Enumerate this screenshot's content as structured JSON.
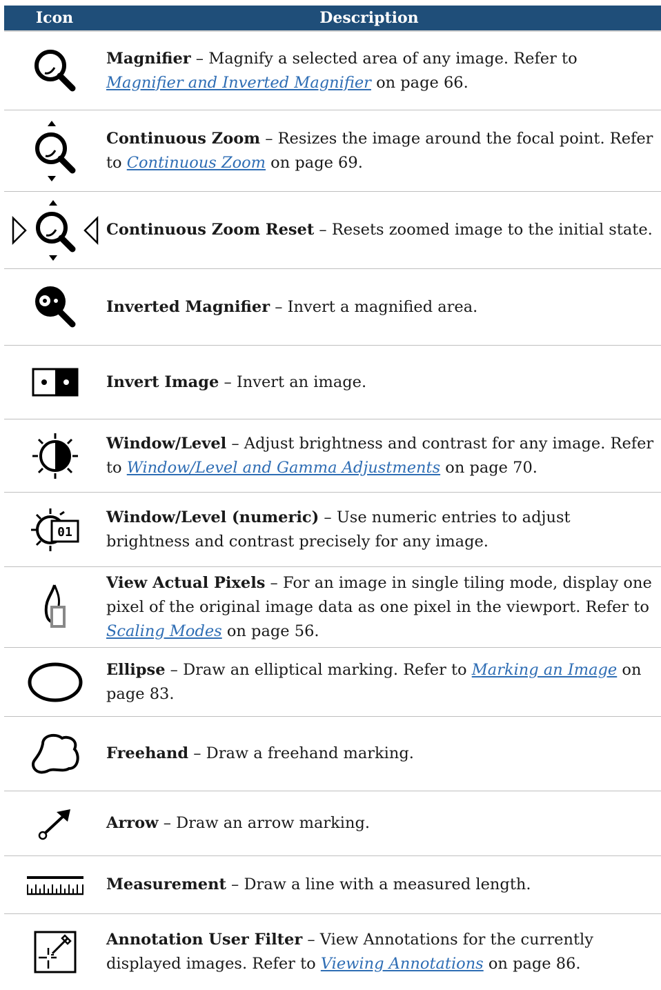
{
  "header": {
    "icon_col": "Icon",
    "desc_col": "Description"
  },
  "rows": [
    {
      "title": "Magnifier",
      "sep": " – ",
      "text": "Magnify a selected area of any image. Refer to ",
      "link": "Magnifier and Inverted Magnifier",
      "tail": " on page 66.",
      "icon": "magnifier-icon"
    },
    {
      "title": "Continuous Zoom",
      "sep": " – ",
      "text": "Resizes the image around the focal point. Refer to ",
      "link": "Continuous Zoom",
      "tail": " on page 69.",
      "icon": "continuous-zoom-icon"
    },
    {
      "title": "Continuous Zoom Reset",
      "sep": " – ",
      "text": "Resets zoomed image to the initial state.",
      "icon": "continuous-zoom-reset-icon"
    },
    {
      "title": "Inverted Magnifier",
      "sep": " – ",
      "text": "Invert a magnified area.",
      "icon": "inverted-magnifier-icon"
    },
    {
      "title": "Invert Image",
      "sep": " – ",
      "text": "Invert an image.",
      "icon": "invert-image-icon"
    },
    {
      "title": "Window/Level",
      "sep": " – ",
      "text": "Adjust brightness and contrast for any image. Refer to ",
      "link": "Window/Level and Gamma Adjustments",
      "tail": " on page 70.",
      "icon": "window-level-icon"
    },
    {
      "title": "Window/Level (numeric)",
      "sep": " – ",
      "text": "Use numeric entries to adjust brightness and contrast precisely for any image.",
      "icon": "window-level-numeric-icon",
      "icon_label": "01"
    },
    {
      "title": "View Actual Pixels",
      "sep": " – ",
      "text": "For an image in single tiling mode, display one pixel of the original image data as one pixel in the viewport. Refer to ",
      "link": "Scaling Modes",
      "tail": " on page 56.",
      "icon": "view-actual-pixels-icon"
    },
    {
      "title": "Ellipse",
      "sep": " – ",
      "text": "Draw an elliptical marking. Refer to ",
      "link": "Marking an Image",
      "tail": " on page 83.",
      "icon": "ellipse-icon"
    },
    {
      "title": "Freehand",
      "sep": " – ",
      "text": "Draw a freehand marking.",
      "icon": "freehand-icon"
    },
    {
      "title": "Arrow",
      "sep": " – ",
      "text": "Draw an arrow marking.",
      "icon": "arrow-icon"
    },
    {
      "title": "Measurement",
      "sep": " – ",
      "text": "Draw a line with a measured length.",
      "icon": "measurement-icon"
    },
    {
      "title": "Annotation User Filter",
      "sep": " – ",
      "text": "View Annotations for the currently displayed images. Refer to ",
      "link": "Viewing Annotations",
      "tail": " on page 86.",
      "icon": "annotation-user-filter-icon"
    }
  ],
  "colors": {
    "header_bg": "#1f4e79",
    "link": "#2e6db4",
    "rule": "#bfbfbf"
  }
}
